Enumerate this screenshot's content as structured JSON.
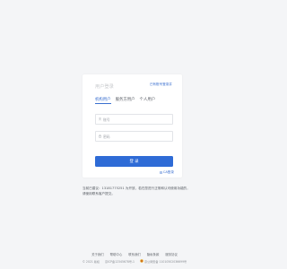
{
  "login": {
    "title": "用户登录",
    "register_link": "已有账号登录并",
    "tabs": [
      {
        "label": "机构用户",
        "active": true
      },
      {
        "label": "服务方用户",
        "active": false
      },
      {
        "label": "个人用户",
        "active": false
      }
    ],
    "username_placeholder": "账号",
    "password_placeholder": "密码",
    "submit_label": "登 录",
    "ca_login_label": "CA登录"
  },
  "notice": {
    "text": "当前已建议：13181775251 为开放，若在您进行正常和认可使用功能的，请使用联系客户提交。"
  },
  "footer": {
    "links": [
      "关于我们",
      "帮助中心",
      "联系我们",
      "隐私条款",
      "服务协议"
    ],
    "copyright": "© 2021 版权",
    "icp": "京ICP备12345678号-1",
    "police": "京公网安备 11010502036699号"
  },
  "colors": {
    "accent": "#2e6bd6",
    "link": "#3a6fcf",
    "background": "#f4f5f7"
  },
  "icons": [
    "user-icon",
    "lock-icon",
    "ca-certificate-icon",
    "police-emblem-icon"
  ]
}
